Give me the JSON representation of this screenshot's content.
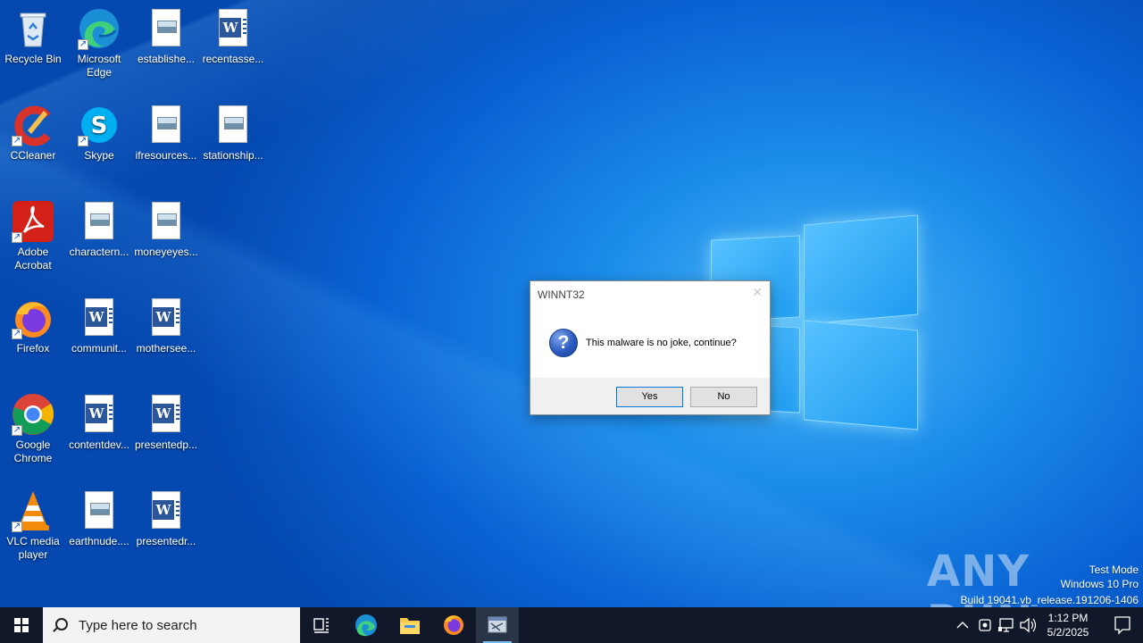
{
  "desktop": {
    "icons": [
      {
        "label": "Recycle Bin",
        "icon": "recycle-bin-icon"
      },
      {
        "label": "Microsoft Edge",
        "icon": "edge-icon"
      },
      {
        "label": "establishe...",
        "icon": "image-file-icon"
      },
      {
        "label": "recentasse...",
        "icon": "word-doc-icon"
      },
      {
        "label": "CCleaner",
        "icon": "ccleaner-icon"
      },
      {
        "label": "Skype",
        "icon": "skype-icon"
      },
      {
        "label": "ifresources...",
        "icon": "image-file-icon"
      },
      {
        "label": "stationship...",
        "icon": "image-file-icon"
      },
      {
        "label": "Adobe Acrobat",
        "icon": "acrobat-icon"
      },
      {
        "label": "charactern...",
        "icon": "image-file-icon"
      },
      {
        "label": "moneyeyes...",
        "icon": "image-file-icon"
      },
      {
        "label": "Firefox",
        "icon": "firefox-icon"
      },
      {
        "label": "communit...",
        "icon": "word-doc-icon"
      },
      {
        "label": "motherseе...",
        "icon": "word-doc-icon"
      },
      {
        "label": "Google Chrome",
        "icon": "chrome-icon"
      },
      {
        "label": "contentdev...",
        "icon": "word-doc-icon"
      },
      {
        "label": "presentedp...",
        "icon": "word-doc-icon"
      },
      {
        "label": "VLC media player",
        "icon": "vlc-icon"
      },
      {
        "label": "earthnude....",
        "icon": "image-file-icon"
      },
      {
        "label": "presentedr...",
        "icon": "word-doc-icon"
      }
    ]
  },
  "dialog": {
    "title": "WINNT32",
    "close_glyph": "✕",
    "icon": "question-icon",
    "icon_glyph": "?",
    "message": "This malware is no joke, continue?",
    "yes_label": "Yes",
    "no_label": "No"
  },
  "watermark": {
    "brand": "ANY RUN",
    "line1": "Test Mode",
    "line2": "Windows 10 Pro",
    "line3": "Build 19041.vb_release.191206-1406"
  },
  "taskbar": {
    "search_placeholder": "Type here to search",
    "time": "1:12 PM",
    "date": "5/2/2025"
  }
}
